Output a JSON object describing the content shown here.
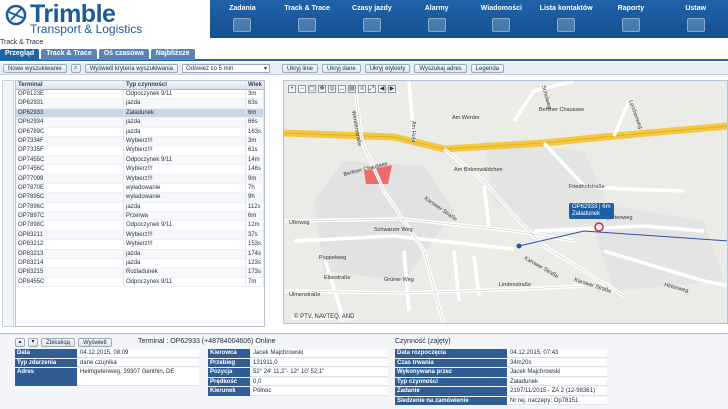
{
  "brand": {
    "name": "Trimble",
    "subtitle": "Transport & Logistics"
  },
  "breadcrumb": "Track & Trace",
  "topnav": [
    {
      "label": "Zadania",
      "icon": "tasks-icon"
    },
    {
      "label": "Track & Trace",
      "icon": "map-icon"
    },
    {
      "label": "Czasy jazdy",
      "icon": "clock-icon"
    },
    {
      "label": "Alarmy",
      "icon": "alarm-icon"
    },
    {
      "label": "Wiadomości",
      "icon": "message-icon"
    },
    {
      "label": "Lista kontaktów",
      "icon": "contacts-icon"
    },
    {
      "label": "Raporty",
      "icon": "report-icon"
    },
    {
      "label": "Ustaw",
      "icon": "settings-icon"
    }
  ],
  "tabs": [
    "Przegląd",
    "Track & Trace",
    "Oś czasowa",
    "Najbliższe"
  ],
  "toolbar": {
    "new_search": "Nowe wyszukiwanie",
    "criteria": "Wyświetl kryteria wyszukiwania",
    "refresh_select": "Odśwież co 5 min",
    "hide_lines": "Ukryj linie",
    "hide_data": "Ukryj dane",
    "hide_labels": "Ukryj etykiety",
    "search_address": "Wyszukaj adres",
    "legend": "Legenda"
  },
  "grid": {
    "headers": [
      "Terminal",
      "Typ czynności",
      "Wiek"
    ],
    "rows": [
      [
        "OP8123E",
        "Odpoczynek 9/11",
        "3m"
      ],
      [
        "OP62931",
        "jazda",
        "63s"
      ],
      [
        "OP62933",
        "Załadunek",
        "6m"
      ],
      [
        "OP62934",
        "jazda",
        "66s"
      ],
      [
        "OP6789C",
        "jazda",
        "163s"
      ],
      [
        "OP7334F",
        "Wybierz!!!",
        "3m"
      ],
      [
        "OP7335F",
        "Wybierz!!!",
        "61s"
      ],
      [
        "OP7455C",
        "Odpoczynek 9/11",
        "14m"
      ],
      [
        "OP7456C",
        "Wybierz!!!",
        "146s"
      ],
      [
        "OP77099",
        "Wybierz!!!",
        "9m"
      ],
      [
        "OP7870E",
        "wyładowanie",
        "7h"
      ],
      [
        "OP7895C",
        "wyładowanie",
        "9h"
      ],
      [
        "OP7896C",
        "jazda",
        "112s"
      ],
      [
        "OP7897C",
        "Przerwa",
        "6m"
      ],
      [
        "OP7898C",
        "Odpoczynek 9/11",
        "12m"
      ],
      [
        "OP83211",
        "Wybierz!!!",
        "37s"
      ],
      [
        "OP83212",
        "Wybierz!!!",
        "153s"
      ],
      [
        "OP83213",
        "jazda",
        "174s"
      ],
      [
        "OP83214",
        "jazda",
        "123s"
      ],
      [
        "OP83215",
        "Rozładunek",
        "173s"
      ],
      [
        "OP8455C",
        "Odpoczynek 9/11",
        "7m"
      ]
    ]
  },
  "map": {
    "streets": [
      "Am Werder",
      "Berliner Chaussee",
      "Berliner Chaussee",
      "Am Birkenwäldchen",
      "Friedhofstraße",
      "Karower Straße",
      "Schwarzer Weg",
      "Uferweg",
      "Heimgartenweg",
      "Karower Straße",
      "Elbestraße",
      "Grüner Weg",
      "Pappelweg",
      "Lindenstraße",
      "Karower Straße",
      "Ulmenstraße",
      "Wendenstraße",
      "Am Hofe",
      "Schulweg",
      "Lerchenweg",
      "Hirtenweg"
    ],
    "popup_line1": "OP62933 | 6m",
    "popup_line2": "Załadunek",
    "credit": "© PTV, NAVTEQ, AND"
  },
  "details": {
    "hide_label": "Zbikaliqą",
    "show_label": "Wyświetl",
    "title": "Terminal : OP62933 (+48784004606)  Online",
    "activity_title": "Czynność (zajęty)",
    "left": [
      [
        "Data",
        "04.12.2015, 08:09"
      ],
      [
        "Typ zdarzenia",
        "dane czujnika"
      ],
      [
        "Adres",
        "Heimgetenweg, 39307 Genthin, DE"
      ]
    ],
    "mid": [
      [
        "Kierowca",
        "Jacek Majchrowski"
      ],
      [
        "Przebieg",
        "131911,0"
      ],
      [
        "Pozycja",
        "52° 24' 11,2\"- 12° 10' 52,1\""
      ],
      [
        "Prędkość",
        "0,0"
      ],
      [
        "Kierunek",
        "Północ"
      ]
    ],
    "right": [
      [
        "Data rozpoczęcia",
        "04.12.2015, 07:43"
      ],
      [
        "Czas trwania",
        "34m20s"
      ],
      [
        "Wykonywana przez",
        "Jacek Majchrowski"
      ],
      [
        "Typ czynności",
        "Załadunek"
      ],
      [
        "Zadanie",
        "2197/11/2015 - ZA 2 (12-98361)"
      ],
      [
        "Śledzenie na zamówienie",
        "Nr rej. naczepy: Op78151"
      ]
    ]
  }
}
